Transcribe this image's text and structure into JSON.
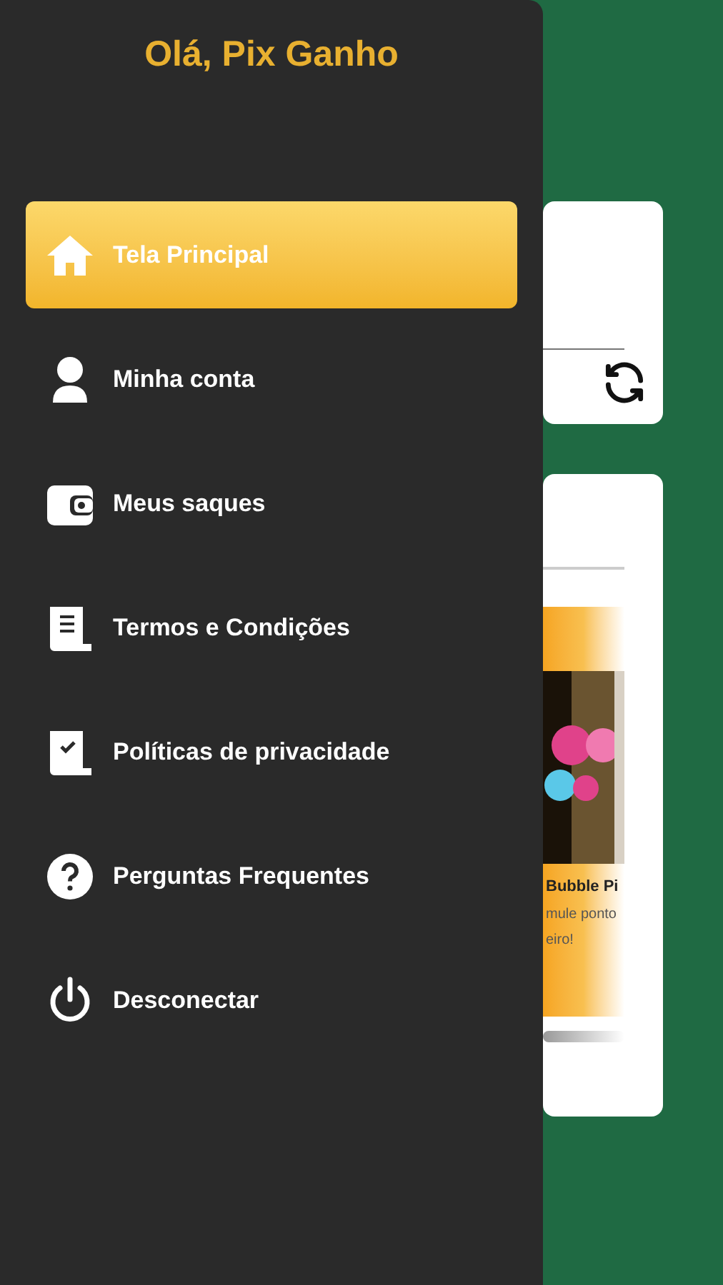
{
  "drawer": {
    "greeting": "Olá, Pix Ganho",
    "items": [
      {
        "kind": "home",
        "label": "Tela Principal",
        "selected": true
      },
      {
        "kind": "user",
        "label": "Minha conta",
        "selected": false
      },
      {
        "kind": "wallet",
        "label": "Meus saques",
        "selected": false
      },
      {
        "kind": "terms",
        "label": "Termos e Condições",
        "selected": false
      },
      {
        "kind": "privacy",
        "label": "Políticas de privacidade",
        "selected": false
      },
      {
        "kind": "faq",
        "label": "Perguntas Frequentes",
        "selected": false
      },
      {
        "kind": "logout",
        "label": "Desconectar",
        "selected": false
      }
    ]
  },
  "game_card": {
    "title": "Bubble Pi",
    "description_lines": [
      "mule ponto",
      "eiro!"
    ]
  }
}
